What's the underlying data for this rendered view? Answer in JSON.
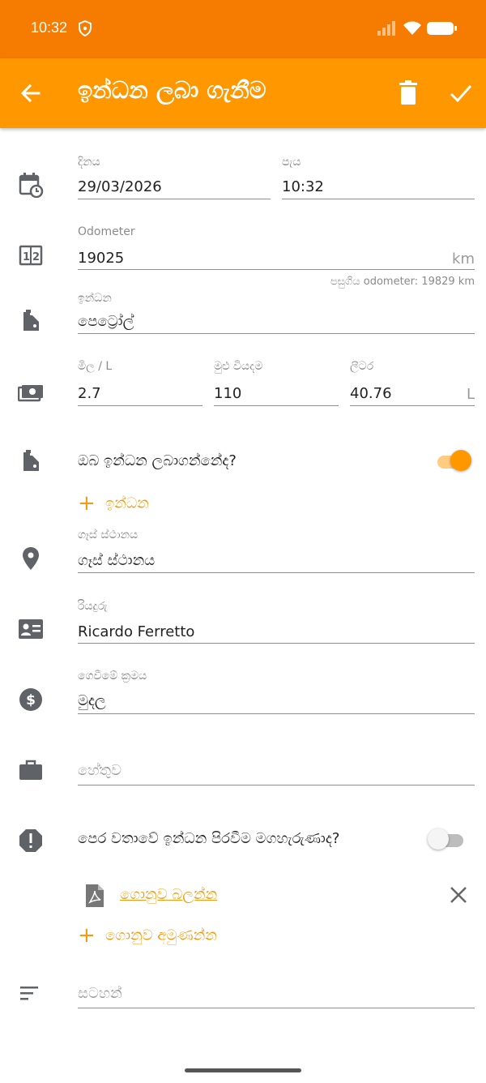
{
  "status_bar": {
    "time": "10:32"
  },
  "app_bar": {
    "title": "ඉන්ධන ලබා ගැනීම"
  },
  "form": {
    "date": {
      "label": "දිනය",
      "value": "29/03/2026"
    },
    "time": {
      "label": "පැය",
      "value": "10:32"
    },
    "odometer": {
      "label": "Odometer",
      "value": "19025",
      "unit": "km",
      "hint": "පසුගිය odometer: 19829 km"
    },
    "fuel": {
      "label": "ඉන්ධන",
      "value": "පෙට්‍රෝල්"
    },
    "price_per_l": {
      "label": "මිල / L",
      "value": "2.7"
    },
    "total_cost": {
      "label": "මුළු වියදම",
      "value": "110"
    },
    "liters": {
      "label": "ලීටර",
      "value": "40.76",
      "unit": "L"
    },
    "full_tank": {
      "label": "ඔබ ඉන්ධන ලබාගන්නේද?",
      "on": true
    },
    "add_fuel": {
      "label": "ඉන්ධන"
    },
    "gas_station": {
      "label": "ගෑස් ස්ථානය",
      "value": "ගෑස් ස්ථානය"
    },
    "driver": {
      "label": "රියදුරු",
      "value": "Ricardo Ferretto"
    },
    "payment": {
      "label": "ගෙවීමේ ක්‍රමය",
      "value": "මුදල"
    },
    "reason": {
      "placeholder": "හේතුව"
    },
    "missed_previous": {
      "label": "පෙර වතාවේ ඉන්ධන පිරවීම මගහැරුණාද?",
      "on": false
    },
    "document": {
      "label": "ගොනුව බලන්න"
    },
    "attach": {
      "label": "ගොනුව අමුණන්න"
    },
    "notes": {
      "placeholder": "සටහන්"
    }
  },
  "colors": {
    "status_bar": "#F57C00",
    "app_bar": "#FF9800",
    "accent": "#F39C12"
  }
}
